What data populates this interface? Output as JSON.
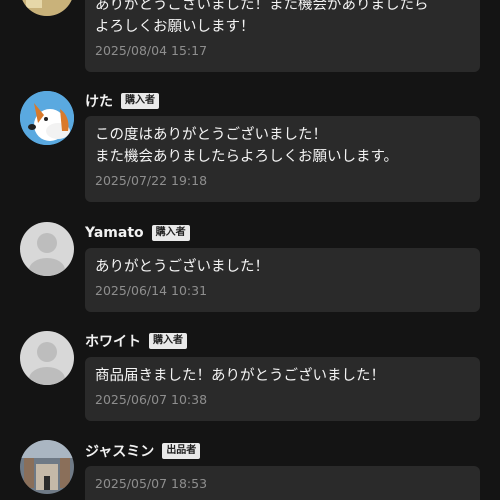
{
  "comments": [
    {
      "name": "",
      "badge": "",
      "message": "ありがとうございました！また機会がありましたら\nよろしくお願いします！",
      "timestamp": "2025/08/04 15:17",
      "avatar": "photo-icon"
    },
    {
      "name": "けた",
      "badge": "購入者",
      "message": "この度はありがとうございました！\nまた機会ありましたらよろしくお願いします。",
      "timestamp": "2025/07/22 19:18",
      "avatar": "dog-icon"
    },
    {
      "name": "Yamato",
      "badge": "購入者",
      "message": "ありがとうございました！",
      "timestamp": "2025/06/14 10:31",
      "avatar": "default-user-icon"
    },
    {
      "name": "ホワイト",
      "badge": "購入者",
      "message": "商品届きました！ありがとうございました！",
      "timestamp": "2025/06/07 10:38",
      "avatar": "default-user-icon"
    },
    {
      "name": "ジャスミン",
      "badge": "出品者",
      "message": "",
      "timestamp": "2025/05/07 18:53",
      "avatar": "photo-icon"
    }
  ],
  "colors": {
    "background": "#141414",
    "bubble": "#2a2a2a",
    "timestamp": "#8e8e8e",
    "badge_bg": "#e9e9e9"
  }
}
